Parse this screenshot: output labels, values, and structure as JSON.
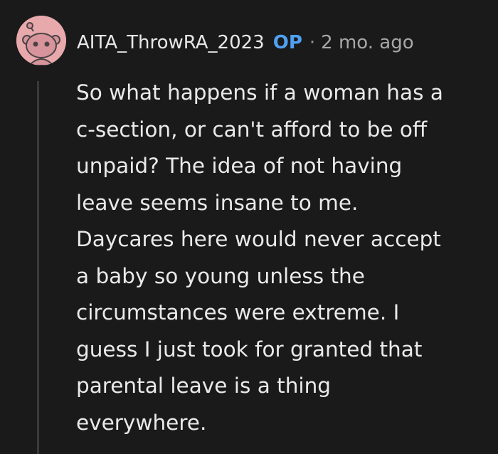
{
  "comment": {
    "author": "AITA_ThrowRA_2023",
    "op_badge": "OP",
    "separator": "·",
    "timestamp": "2 mo. ago",
    "avatar_icon": "snoo-avatar-icon",
    "avatar_color": "#e8a9ad",
    "body_lines": [
      "So what happens if a woman has a",
      "c-section, or can't afford to be off",
      "unpaid? The idea of not having",
      "leave seems insane to me.",
      "Daycares here would never accept",
      "a baby so young unless the",
      "circumstances were extreme. I",
      "guess I just took for granted that",
      "parental leave is a thing",
      "everywhere."
    ]
  },
  "colors": {
    "background": "#1a1a1b",
    "text": "#eaeaea",
    "op_badge": "#4fa1f2",
    "meta": "#a8a8a8",
    "thread_line": "#3a3a3c"
  }
}
